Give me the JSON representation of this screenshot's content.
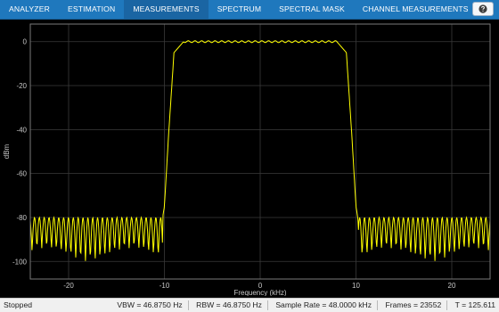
{
  "toolstrip": {
    "tabs": [
      {
        "label": "ANALYZER"
      },
      {
        "label": "ESTIMATION"
      },
      {
        "label": "MEASUREMENTS"
      },
      {
        "label": "SPECTRUM"
      },
      {
        "label": "SPECTRAL MASK"
      },
      {
        "label": "CHANNEL MEASUREMENTS"
      }
    ],
    "active_tab": "MEASUREMENTS",
    "help_icon": "question-mark-icon",
    "colors": {
      "bar": "#1f78bd",
      "text": "#ffffff"
    }
  },
  "chart_data": {
    "type": "line",
    "xlabel": "Frequency (kHz)",
    "ylabel": "dBm",
    "xlim": [
      -24,
      24
    ],
    "ylim": [
      -108,
      8
    ],
    "xticks": [
      -20,
      -10,
      0,
      10,
      20
    ],
    "yticks": [
      0,
      -20,
      -40,
      -60,
      -80,
      -100
    ],
    "grid": true,
    "background": "#000000",
    "line_color": "#ffff00",
    "series": [
      {
        "x": [
          -24,
          -20,
          -15,
          -10.4,
          -10,
          -9.6,
          -9,
          -8,
          0,
          8,
          9,
          9.6,
          10,
          10.4,
          15,
          20,
          24
        ],
        "values": [
          -87,
          -88,
          -87,
          -86,
          -75,
          -45,
          -5,
          0,
          0,
          0,
          -5,
          -45,
          -75,
          -86,
          -87,
          -88,
          -87
        ],
        "stopband_ripple": {
          "upper": -80,
          "lower": -100
        }
      }
    ]
  },
  "statusbar": {
    "state": "Stopped",
    "vbw": "VBW = 46.8750 Hz",
    "rbw": "RBW = 46.8750 Hz",
    "sample_rate": "Sample Rate = 48.0000 kHz",
    "frames": "Frames = 23552",
    "time": "T = 125.611"
  }
}
